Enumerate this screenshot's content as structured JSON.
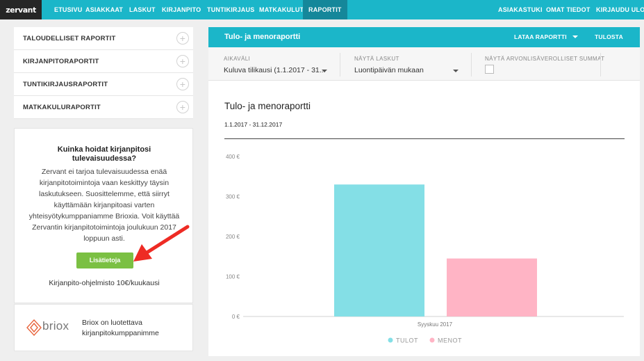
{
  "nav": {
    "logo": "zervant",
    "items": [
      {
        "label": "ETUSIVU"
      },
      {
        "label": "ASIAKKAAT"
      },
      {
        "label": "LASKUT"
      },
      {
        "label": "KIRJANPITO"
      },
      {
        "label": "TUNTIKIRJAUS"
      },
      {
        "label": "MATKAKULUT"
      },
      {
        "label": "RAPORTIT",
        "active": true
      }
    ],
    "right": [
      {
        "label": "ASIAKASTUKI"
      },
      {
        "label": "OMAT TIEDOT"
      },
      {
        "label": "KIRJAUDU ULOS"
      }
    ],
    "bg_color": "#1bb6c9",
    "active_color": "#15879a"
  },
  "sidebar": {
    "reports": [
      {
        "label": "TALOUDELLISET RAPORTIT",
        "icon": "plus-circle-icon"
      },
      {
        "label": "KIRJANPITORAPORTIT",
        "icon": "plus-circle-icon"
      },
      {
        "label": "TUNTIKIRJAUSRAPORTIT",
        "icon": "plus-circle-icon"
      },
      {
        "label": "MATKAKULURAPORTIT",
        "icon": "plus-circle-icon"
      }
    ],
    "promo": {
      "title": "Kuinka hoidat kirjanpitosi tulevaisuudessa?",
      "text": "Zervant ei tarjoa tulevaisuudessa enää kirjanpitotoimintoja vaan keskittyy täysin laskutukseen. Suosittelemme, että siirryt käyttämään kirjanpitoasi varten yhteisyötykumppaniamme Brioxia. Voit käyttää Zervantin kirjanpitotoimintoja joulukuun 2017 loppuun asti.",
      "button": "Lisätietoja",
      "price": "Kirjanpito-ohjelmisto 10€/kuukausi"
    },
    "briox": {
      "logo_text": "briox",
      "text": "Briox on luotettava kirjanpitokumppanimme"
    }
  },
  "panel": {
    "title": "Tulo- ja menoraportti",
    "download": "LATAA RAPORTTI",
    "print": "TULOSTA",
    "filters": {
      "period_label": "AIKAVÄLI",
      "period_value": "Kuluva tilikausi (1.1.2017 - 31...",
      "invoices_label": "NÄYTÄ LASKUT",
      "invoices_value": "Luontipäivän mukaan",
      "vat_label": "NÄYTÄ ARVONLISÄVEROLLISET SUMMAT",
      "vat_checked": false
    },
    "report_title": "Tulo- ja menoraportti",
    "report_range": "1.1.2017 - 31.12.2017"
  },
  "chart_data": {
    "type": "bar",
    "categories": [
      "Syyskuu 2017"
    ],
    "series": [
      {
        "name": "TULOT",
        "values": [
          330
        ],
        "color": "#84dfe6"
      },
      {
        "name": "MENOT",
        "values": [
          145
        ],
        "color": "#ffb4c5"
      }
    ],
    "yticks": [
      "0 €",
      "100 €",
      "200 €",
      "300 €",
      "400 €"
    ],
    "ylim": [
      0,
      400
    ],
    "grid": false,
    "legend": "bottom"
  }
}
